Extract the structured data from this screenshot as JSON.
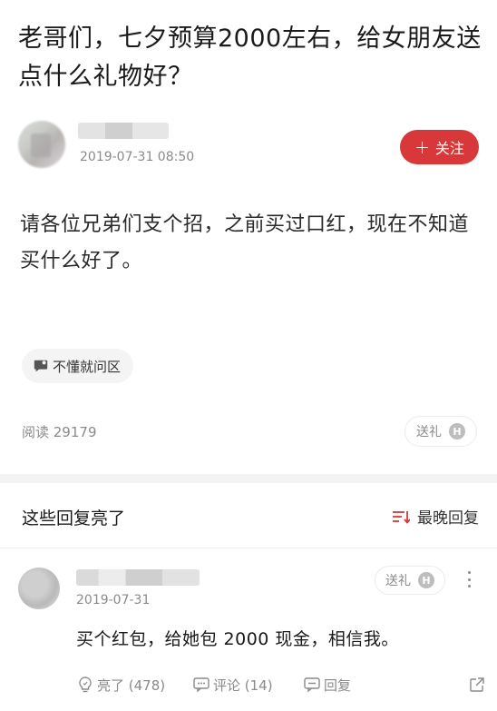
{
  "question": {
    "title": "老哥们，七夕预算2000左右，给女朋友送点什么礼物好？",
    "time": "2019-07-31 08:50",
    "follow_label": "关注",
    "body": "请各位兄弟们支个招，之前买过口红，现在不知道买什么好了。",
    "topic_label": "不懂就问区",
    "read_count": "阅读 29179",
    "gift_label": "送礼",
    "coin_label": "H"
  },
  "replies_section": {
    "title": "这些回复亮了",
    "sort_label": "最晚回复"
  },
  "reply": {
    "date": "2019-07-31",
    "gift_label": "送礼",
    "coin_label": "H",
    "text": "买个红包，给她包 2000 现金，相信我。",
    "like_label": "亮了 (478)",
    "comment_label": "评论 (14)",
    "reply_label": "回复"
  },
  "colors": {
    "accent": "#d8383a",
    "muted_text": "#8a8a8a"
  },
  "icons": [
    "plus-icon",
    "chat-bubble-icon",
    "coin-icon",
    "sort-icon",
    "more-icon",
    "lightbulb-icon",
    "comment-icon",
    "reply-icon",
    "share-icon"
  ]
}
